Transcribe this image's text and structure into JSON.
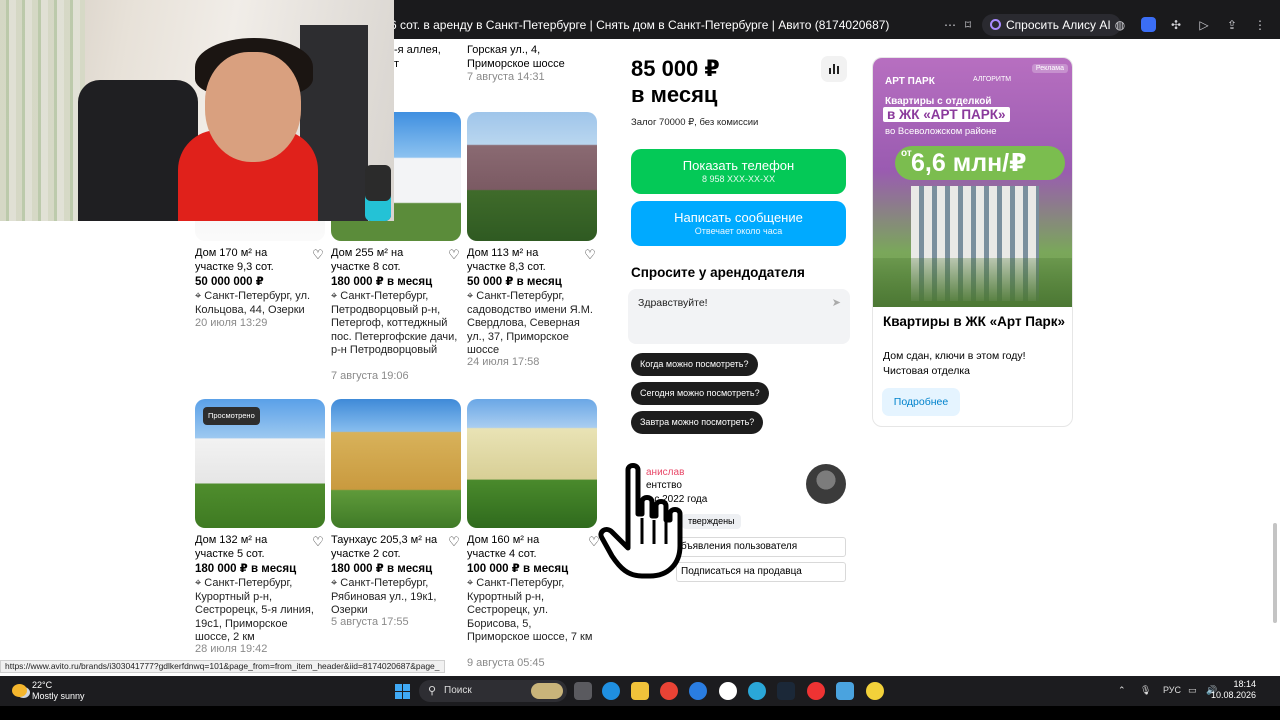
{
  "browser": {
    "tab_title": "6 сот. в аренду в Санкт-Петербурге | Снять дом в Санкт-Петербурге | Авито (8174020687)",
    "alice_label": "Спросить Алису AI"
  },
  "top_partials": {
    "left_line1": "-я аллея,",
    "left_line2": "т",
    "right_line1": "Горская ул., 4,",
    "right_line2": "Приморское шоссе",
    "right_date": "7 августа 14:31"
  },
  "listings": [
    {
      "name": "Дом 170 м² на участке 9,3 сот.",
      "price": "50 000 000 ₽",
      "address": "Санкт-Петербург, ул. Кольцова, 44, Озерки",
      "date": "20 июля 13:29",
      "badge": ""
    },
    {
      "name": "Дом 255 м² на участке 8 сот.",
      "price": "180 000 ₽ в месяц",
      "address": "Санкт-Петербург, Петродворцовый р-н, Петергоф, коттеджный пос. Петергофские дачи, р-н Петродворцовый",
      "date": "7 августа 19:06",
      "badge": ""
    },
    {
      "name": "Дом 113 м² на участке 8,3 сот.",
      "price": "50 000 ₽ в месяц",
      "address": "Санкт-Петербург, садоводство имени Я.М. Свердлова, Северная ул., 37, Приморское шоссе",
      "date": "24 июля 17:58",
      "badge": ""
    },
    {
      "name": "Дом 132 м² на участке 5 сот.",
      "price": "180 000 ₽ в месяц",
      "address": "Санкт-Петербург, Курортный р-н, Сестрорецк, 5-я линия, 19с1, Приморское шоссе, 2 км",
      "date": "28 июля 19:42",
      "badge": "Просмотрено"
    },
    {
      "name": "Таунхаус 205,3 м² на участке 2 сот.",
      "price": "180 000 ₽ в месяц",
      "address": "Санкт-Петербург, Рябиновая ул., 19к1, Озерки",
      "date": "5 августа 17:55",
      "badge": ""
    },
    {
      "name": "Дом 160 м² на участке 4 сот.",
      "price": "100 000 ₽ в месяц",
      "address": "Санкт-Петербург, Курортный р-н, Сестрорецк, ул. Борисова, 5, Приморское шоссе, 7 км",
      "date": "9 августа 05:45",
      "badge": ""
    }
  ],
  "offer": {
    "price_line1": "85 000 ₽",
    "price_line2": "в месяц",
    "deposit": "Залог 70000 ₽, без комиссии",
    "show_phone": "Показать телефон",
    "phone_mask": "8 958 XXX-XX-XX",
    "write_message": "Написать сообщение",
    "reply_time": "Отвечает около часа"
  },
  "ask": {
    "title": "Спросите у арендодателя",
    "message": "Здравствуйте!",
    "chips": [
      "Когда можно посмотреть?",
      "Сегодня можно посмотреть?",
      "Завтра можно посмотреть?"
    ]
  },
  "seller": {
    "name": "анислав",
    "type": "ентство",
    "since": "о с 2022 года",
    "confirmed": "тверждены",
    "all_ads": "бъявления пользователя",
    "subscribe": "Подписаться на продавца"
  },
  "ad": {
    "tag": "Реклама",
    "logo1": "АРТ ПАРК",
    "logo2": "АЛГОРИТМ",
    "line1": "Квартиры с отделкой",
    "line2": "в ЖК «АРТ ПАРК»",
    "line3": "во Всеволожском районе",
    "offer_pre": "от",
    "offer_main": "6,6 млн/₽",
    "title": "Квартиры в ЖК «Арт Парк»",
    "text1": "Дом сдан, ключи в этом году!",
    "text2": "Чистовая отделка",
    "button": "Подробнее"
  },
  "status_url": "https://www.avito.ru/brands/i303041777?gdlkerfdnwq=101&page_from=from_item_header&iid=8174020687&page_",
  "taskbar": {
    "temp": "22°C",
    "weather": "Mostly sunny",
    "search": "Поиск",
    "lang": "РУС",
    "time": "18:14",
    "date": "10.08.2026"
  },
  "colors": {
    "green_button": "#04c957",
    "blue_button": "#00aaff",
    "seller_name": "#e84868"
  }
}
